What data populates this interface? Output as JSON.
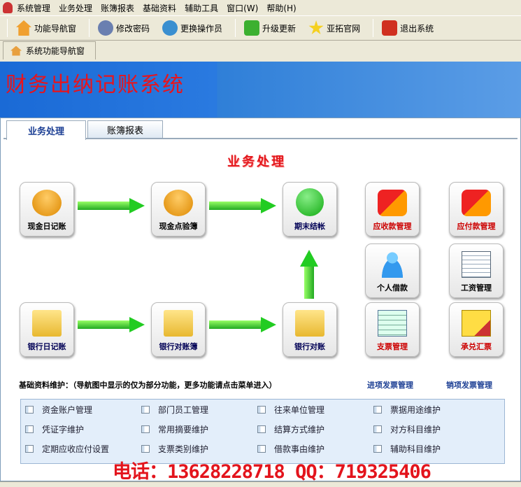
{
  "menu": [
    "系统管理",
    "业务处理",
    "账簿报表",
    "基础资料",
    "辅助工具",
    "窗口(W)",
    "帮助(H)"
  ],
  "toolbar": [
    {
      "label": "功能导航窗",
      "icon": "home-icon",
      "color": "#f0a030"
    },
    {
      "label": "修改密码",
      "icon": "user-key-icon",
      "color": "#6a7fb0"
    },
    {
      "label": "更换操作员",
      "icon": "switch-user-icon",
      "color": "#3a8fd0"
    },
    {
      "label": "升级更新",
      "icon": "rss-icon",
      "color": "#3cb030"
    },
    {
      "label": "亚拓官网",
      "icon": "star-icon",
      "color": "#f5d020"
    },
    {
      "label": "退出系统",
      "icon": "power-icon",
      "color": "#d03020"
    }
  ],
  "doc_tab": "系统功能导航窗",
  "banner_title": "财务出纳记账系统",
  "tabs": [
    "业务处理",
    "账簿报表"
  ],
  "section_title": "业务处理",
  "buttons": {
    "cash_journal": "现金日记账",
    "cash_check": "现金点验簿",
    "period_close": "期末结帐",
    "receivable": "应收款管理",
    "payable": "应付款管理",
    "personal_loan": "个人借款",
    "salary": "工资管理",
    "bank_journal": "银行日记账",
    "bank_recon_book": "银行对账簿",
    "bank_recon": "银行对账",
    "cheque": "支票管理",
    "acceptance": "承兑汇票"
  },
  "basic_label": "基础资料维护：（导航图中显示的仅为部分功能，更多功能请点击菜单进入）",
  "links": [
    "进项发票管理",
    "销项发票管理"
  ],
  "basic_items": [
    "资金账户管理",
    "部门员工管理",
    "往来单位管理",
    "票据用途维护",
    "凭证字维护",
    "常用摘要维护",
    "结算方式维护",
    "对方科目维护",
    "定期应收应付设置",
    "支票类别维护",
    "借款事由维护",
    "辅助科目维护"
  ],
  "contact": "电话：13628228718  QQ：719325406"
}
